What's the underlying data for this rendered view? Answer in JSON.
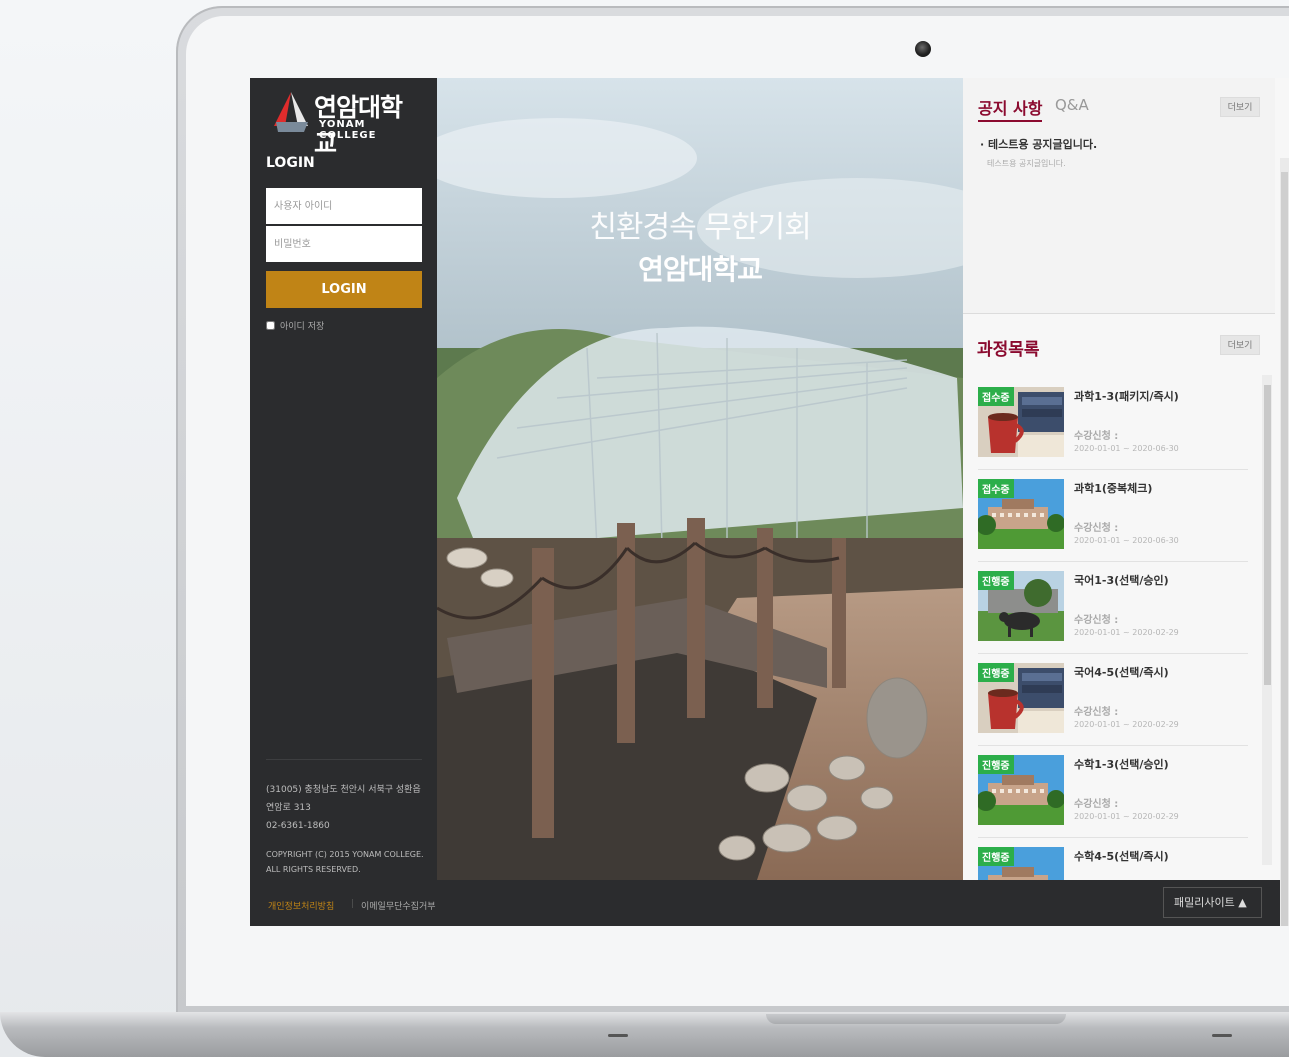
{
  "logo": {
    "name_ko": "연암대학교",
    "name_en": "YONAM COLLEGE"
  },
  "login": {
    "title": "LOGIN",
    "id_placeholder": "사용자 아이디",
    "pw_placeholder": "비밀번호",
    "button": "LOGIN",
    "remember_label": "아이디 저장"
  },
  "sidebar_footer": {
    "address": "(31005) 충청남도 천안시 서북구 성환읍 연암로 313",
    "phone": "02-6361-1860",
    "copyright_line1": "COPYRIGHT (C) 2015 YONAM COLLEGE.",
    "copyright_line2": "ALL RIGHTS RESERVED."
  },
  "hero": {
    "line1": "친환경속 무한기회",
    "line2": "연암대학교"
  },
  "notice": {
    "tab_notice": "공지 사항",
    "tab_qna": "Q&A",
    "more": "더보기",
    "item_title": "· 테스트용 공지글입니다.",
    "item_sub": "테스트용 공지글입니다."
  },
  "courses": {
    "title": "과정목록",
    "more": "더보기",
    "label": "수강신청 :",
    "items": [
      {
        "badge": "접수중",
        "title": "과학1-3(패키지/즉시)",
        "date": "2020-01-01 ~ 2020-06-30",
        "thumb": "cup"
      },
      {
        "badge": "접수중",
        "title": "과학1(중복체크)",
        "date": "2020-01-01 ~ 2020-06-30",
        "thumb": "campus"
      },
      {
        "badge": "진행중",
        "title": "국어1-3(선택/승인)",
        "date": "2020-01-01 ~ 2020-02-29",
        "thumb": "cow"
      },
      {
        "badge": "진행중",
        "title": "국어4-5(선택/즉시)",
        "date": "2020-01-01 ~ 2020-02-29",
        "thumb": "cup"
      },
      {
        "badge": "진행중",
        "title": "수학1-3(선택/승인)",
        "date": "2020-01-01 ~ 2020-02-29",
        "thumb": "campus"
      },
      {
        "badge": "진행중",
        "title": "수학4-5(선택/즉시)",
        "date": "",
        "thumb": "campus"
      }
    ]
  },
  "footer": {
    "privacy": "개인정보처리방침",
    "separator": "|",
    "email_policy": "이메일무단수집거부",
    "family_site": "패밀리사이트 ▲"
  },
  "colors": {
    "accent": "#c08416",
    "brand": "#8b0a2f",
    "badge": "#2cae4a",
    "sidebar": "#2b2c2e"
  }
}
